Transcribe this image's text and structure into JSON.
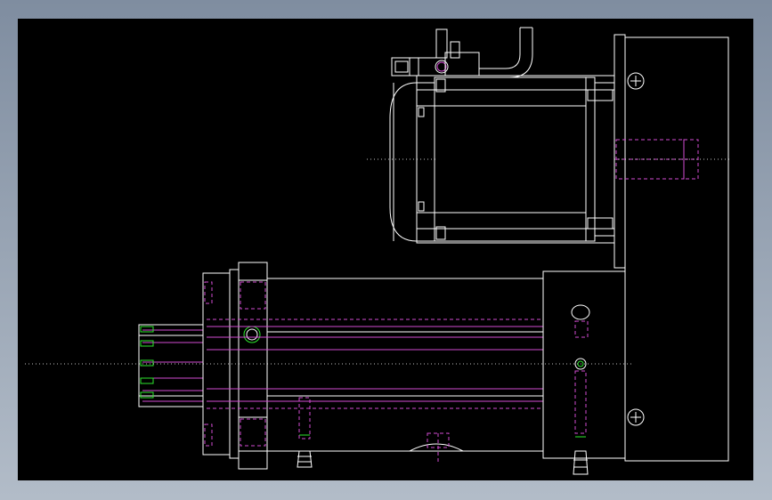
{
  "viewport": {
    "background": "#000000",
    "line_color": "#ffffff",
    "hidden_line_color": "#d24bd2",
    "accent_color": "#2ee62e"
  },
  "drawing": {
    "views": [
      "motor-top-view",
      "cylinder-side-view",
      "mount-plate"
    ],
    "fasteners": [
      "cross-screw-icon",
      "cross-screw-icon"
    ]
  }
}
